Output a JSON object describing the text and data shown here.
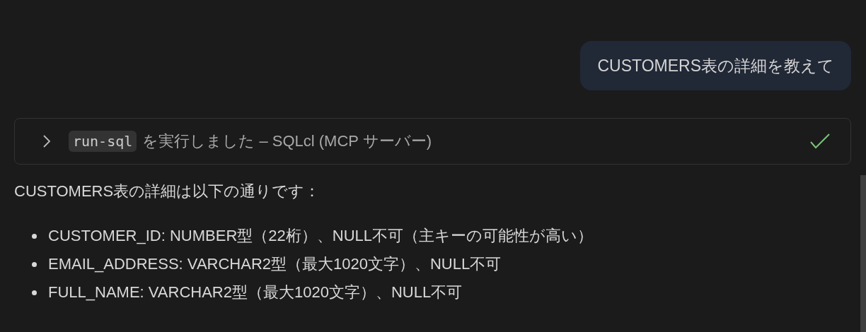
{
  "user_message": "CUSTOMERS表の詳細を教えて",
  "tool_call": {
    "tool": "run-sql",
    "label": "を実行しました – SQLcl (MCP サーバー)",
    "expanded": false,
    "completed": true
  },
  "response": {
    "intro": "CUSTOMERS表の詳細は以下の通りです：",
    "items": [
      "CUSTOMER_ID: NUMBER型（22桁）、NULL不可（主キーの可能性が高い）",
      "EMAIL_ADDRESS: VARCHAR2型（最大1020文字）、NULL不可",
      "FULL_NAME: VARCHAR2型（最大1020文字）、NULL不可"
    ]
  }
}
